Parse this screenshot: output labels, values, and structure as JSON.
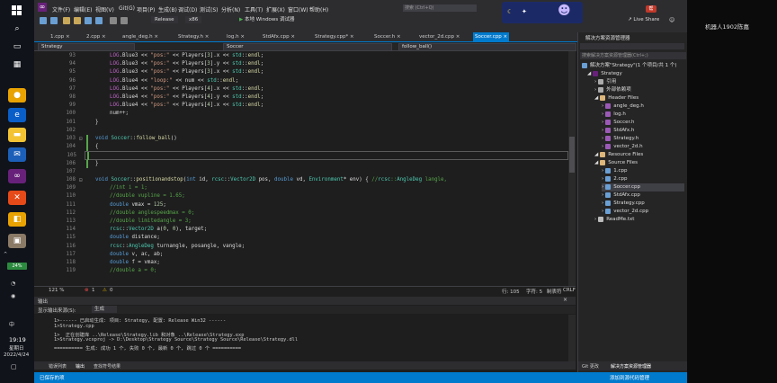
{
  "taskbar": {
    "time": "19:19",
    "day": "星期日",
    "date": "2022/4/24",
    "battery": "24%",
    "lang": "中"
  },
  "menubar": {
    "items": [
      "文件(F)",
      "编辑(E)",
      "视图(V)",
      "Git(G)",
      "项目(P)",
      "生成(B)",
      "调试(D)",
      "测试(S)",
      "分析(N)",
      "工具(T)",
      "扩展(X)",
      "窗口(W)",
      "帮助(H)"
    ],
    "search": "搜索 (Ctrl+Q)",
    "account": "帮",
    "live_share": "Live Share",
    "config": "Release",
    "platform": "x86",
    "run_target": "本地 Windows 调试器"
  },
  "tabs": [
    {
      "label": "1.cpp"
    },
    {
      "label": "2.cpp"
    },
    {
      "label": "angle_deg.h"
    },
    {
      "label": "Strategy.h"
    },
    {
      "label": "log.h"
    },
    {
      "label": "StdAfx.cpp"
    },
    {
      "label": "Strategy.cpp*"
    },
    {
      "label": "Soccer.h"
    },
    {
      "label": "vector_2d.cpp"
    },
    {
      "label": "Soccer.cpp"
    }
  ],
  "navbar": {
    "project": "Strategy",
    "class": "Soccer",
    "member": "follow_ball()"
  },
  "code_lines": [
    {
      "n": "93",
      "t": "LOG.Blue3 << \"pos:\" << Players[3].x << std::endl;"
    },
    {
      "n": "94",
      "t": "LOG.Blue3 << \"pos:\" << Players[3].y << std::endl;"
    },
    {
      "n": "95",
      "t": "LOG.Blue3 << \"pos:\" << Players[3].x << std::endl;"
    },
    {
      "n": "96",
      "t": "LOG.Blue4 << \"loop:\" << num << std::endl;"
    },
    {
      "n": "97",
      "t": "LOG.Blue4 << \"pos:\" << Players[4].x << std::endl;"
    },
    {
      "n": "98",
      "t": "LOG.Blue4 << \"pos:\" << Players[4].y << std::endl;"
    },
    {
      "n": "99",
      "t": "LOG.Blue4 << \"pos:\" << Players[4].x << std::endl;"
    },
    {
      "n": "100",
      "t": "num++;"
    },
    {
      "n": "101",
      "t": "}"
    },
    {
      "n": "102",
      "t": ""
    },
    {
      "n": "103",
      "t": "void Soccer::follow_ball()"
    },
    {
      "n": "104",
      "t": "{"
    },
    {
      "n": "105",
      "t": ""
    },
    {
      "n": "106",
      "t": "}"
    },
    {
      "n": "107",
      "t": ""
    },
    {
      "n": "108",
      "t": "void Soccer::positionandstop(int id, rcsc::Vector2D pos, double vd, Environment* env) { //rcsc::AngleDeg langle,"
    },
    {
      "n": "109",
      "t": "//int i = 1;"
    },
    {
      "n": "110",
      "t": "//double vupline = 1.65;"
    },
    {
      "n": "111",
      "t": "double vmax = 125;"
    },
    {
      "n": "112",
      "t": "//double anglespeedmax = 0;"
    },
    {
      "n": "113",
      "t": "//double limitedangle = 3;"
    },
    {
      "n": "114",
      "t": "rcsc::Vector2D a(0, 0), target;"
    },
    {
      "n": "115",
      "t": "double distance;"
    },
    {
      "n": "116",
      "t": "rcsc::AngleDeg turnangle, posangle, vangle;"
    },
    {
      "n": "117",
      "t": "double v, ac, ab;"
    },
    {
      "n": "118",
      "t": "double f = vmax;"
    },
    {
      "n": "119",
      "t": "//double a = 0;"
    }
  ],
  "editor_status": {
    "zoom": "121 %",
    "errors": "1",
    "warnings": "0",
    "line": "行: 105",
    "col": "字符: 5",
    "mode": "制表符",
    "eol": "CRLF"
  },
  "output": {
    "title": "输出",
    "source_label": "显示输出来源(S):",
    "source_value": "生成",
    "lines": [
      "1>------ 已启动生成: 项目: Strategy, 配置: Release Win32 ------",
      "1>Strategy.cpp",
      "1>  正在创建库 ..\\Release\\Strategy.lib 和对象 ..\\Release\\Strategy.exp",
      "1>Strategy.vcxproj -> D:\\Desktop\\Strategy Source\\Strategy Source\\Release\\Strategy.dll",
      "========== 生成: 成功 1 个, 失败 0 个, 最新 0 个, 跳过 0 个 =========="
    ],
    "tabs": [
      "错误列表",
      "输出",
      "查找符号结果"
    ]
  },
  "statusbar": {
    "left": "已保存的项",
    "right": "添加到源代码管理"
  },
  "solution": {
    "title": "解决方案资源管理器",
    "search": "搜索解决方案资源管理器(Ctrl+;)",
    "root": "解决方案\"Strategy\"(1 个项目/共 1 个)",
    "project": "Strategy",
    "items": [
      {
        "label": "引用",
        "depth": 2,
        "kind": "ref"
      },
      {
        "label": "外部依赖项",
        "depth": 2,
        "kind": "ext"
      },
      {
        "label": "Header Files",
        "depth": 2,
        "kind": "folder"
      },
      {
        "label": "angle_deg.h",
        "depth": 3,
        "kind": "h"
      },
      {
        "label": "log.h",
        "depth": 3,
        "kind": "h"
      },
      {
        "label": "Soccer.h",
        "depth": 3,
        "kind": "h"
      },
      {
        "label": "StdAfx.h",
        "depth": 3,
        "kind": "h"
      },
      {
        "label": "Strategy.h",
        "depth": 3,
        "kind": "h"
      },
      {
        "label": "vector_2d.h",
        "depth": 3,
        "kind": "h"
      },
      {
        "label": "Resource Files",
        "depth": 2,
        "kind": "folder"
      },
      {
        "label": "Source Files",
        "depth": 2,
        "kind": "folder"
      },
      {
        "label": "1.cpp",
        "depth": 3,
        "kind": "cpp"
      },
      {
        "label": "2.cpp",
        "depth": 3,
        "kind": "cpp"
      },
      {
        "label": "Soccer.cpp",
        "depth": 3,
        "kind": "cpp"
      },
      {
        "label": "StdAfx.cpp",
        "depth": 3,
        "kind": "cpp"
      },
      {
        "label": "Strategy.cpp",
        "depth": 3,
        "kind": "cpp"
      },
      {
        "label": "vector_2d.cpp",
        "depth": 3,
        "kind": "cpp"
      },
      {
        "label": "ReadMe.txt",
        "depth": 2,
        "kind": "txt"
      }
    ],
    "bottom_tabs": [
      "Git 更改",
      "解决方案资源管理器"
    ]
  },
  "sidepanel": {
    "label": "机器人1902陈嘉"
  },
  "colors": {
    "accent": "#007acc",
    "vs_purple": "#68217a"
  }
}
